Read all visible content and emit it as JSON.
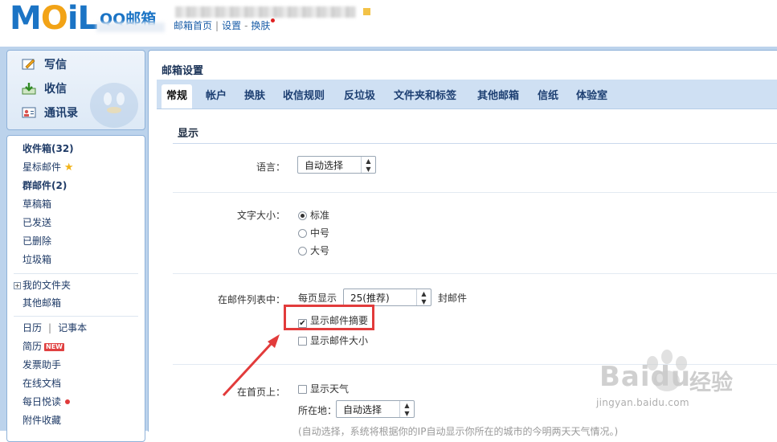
{
  "header": {
    "logo_text": "MOiL",
    "brand": "QQ邮箱",
    "links": [
      "邮箱首页",
      "设置",
      "换肤"
    ],
    "link_sep": "|",
    "link_sep2": "-"
  },
  "compose": {
    "write": "写信",
    "receive": "收信",
    "contacts": "通讯录"
  },
  "folders": {
    "inbox": "收件箱(32)",
    "starred": "星标邮件",
    "group": "群邮件(2)",
    "drafts": "草稿箱",
    "sent": "已发送",
    "deleted": "已删除",
    "trash": "垃圾箱",
    "my_folders": "我的文件夹",
    "other_mail": "其他邮箱",
    "calendar": "日历",
    "cal_sep": "|",
    "notes": "记事本",
    "resume": "简历",
    "resume_badge": "NEW",
    "invoice": "发票助手",
    "docs": "在线文档",
    "daily": "每日悦读",
    "attachments": "附件收藏"
  },
  "main": {
    "title": "邮箱设置",
    "tabs": [
      "常规",
      "帐户",
      "换肤",
      "收信规则",
      "反垃圾",
      "文件夹和标签",
      "其他邮箱",
      "信纸",
      "体验室"
    ],
    "active_tab": "常规",
    "section_display": "显示",
    "language_label": "语言：",
    "language_value": "自动选择",
    "fontsize_label": "文字大小：",
    "fontsize_options": [
      "标准",
      "中号",
      "大号"
    ],
    "fontsize_selected": "标准",
    "list_label": "在邮件列表中：",
    "per_page_prefix": "每页显示",
    "per_page_value": "25(推荐)",
    "per_page_suffix": "封邮件",
    "show_summary": "显示邮件摘要",
    "show_summary_checked": true,
    "show_size": "显示邮件大小",
    "show_size_checked": false,
    "home_label": "在首页上：",
    "show_weather": "显示天气",
    "location_label": "所在地：",
    "location_value": "自动选择",
    "location_hint": "(自动选择，系统将根据你的IP自动显示你所在的城市的今明两天天气情况。)"
  },
  "watermark": {
    "brand": "Bai",
    "brand2": "du",
    "cn": "经验",
    "url": "jingyan.baidu.com"
  },
  "colors": {
    "accent": "#1b74c5",
    "logo_o": "#f2a316",
    "annotation": "#e23b3b",
    "sidebar_bg": "#bcd3ec",
    "tabbar_bg": "#cfe0f3"
  }
}
